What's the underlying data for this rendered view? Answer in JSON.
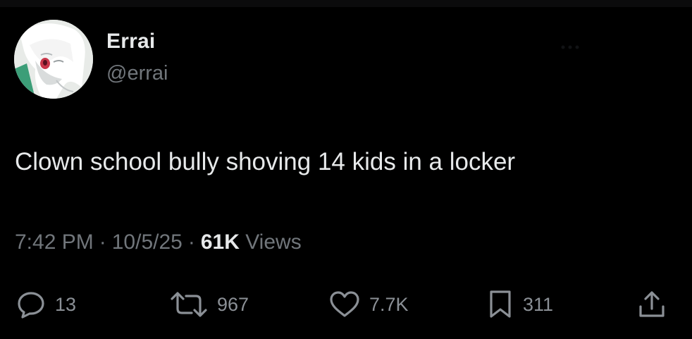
{
  "author": {
    "display_name": "Errai",
    "handle": "@errai",
    "avatar_icon": "anime-avatar-icon"
  },
  "tweet": {
    "text": "Clown school bully shoving 14 kids in a locker",
    "time": "7:42 PM",
    "date": "10/5/25",
    "separator": "·",
    "views_count": "61K",
    "views_label": "Views"
  },
  "actions": {
    "replies": "13",
    "reposts": "967",
    "likes": "7.7K",
    "bookmarks": "311"
  },
  "colors": {
    "background": "#000000",
    "primary_text": "#e7e9ea",
    "secondary_text": "#71767b",
    "icon": "#8b9096"
  }
}
